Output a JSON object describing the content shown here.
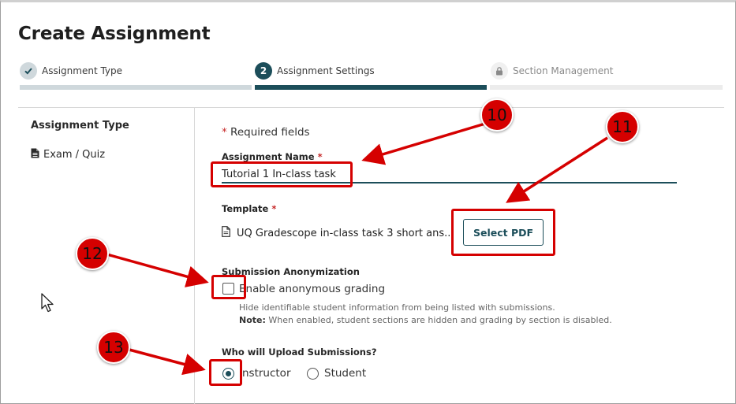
{
  "page": {
    "title": "Create Assignment"
  },
  "stepper": {
    "steps": [
      {
        "label": "Assignment Type",
        "number": "",
        "state": "complete"
      },
      {
        "label": "Assignment Settings",
        "number": "2",
        "state": "active"
      },
      {
        "label": "Section Management",
        "number": "",
        "state": "locked"
      }
    ]
  },
  "sidebar": {
    "heading": "Assignment Type",
    "item": "Exam / Quiz"
  },
  "form": {
    "required_note": "Required fields",
    "required_star": "*",
    "assignment_name": {
      "label": "Assignment Name",
      "value": "Tutorial 1 In-class task"
    },
    "template": {
      "label": "Template",
      "file_name": "UQ Gradescope in-class task 3 short ans...",
      "button": "Select PDF"
    },
    "anonymization": {
      "label": "Submission Anonymization",
      "checkbox_label": "Enable anonymous grading",
      "checked": false,
      "help": "Hide identifiable student information from being listed with submissions.",
      "note_prefix": "Note:",
      "note": "When enabled, student sections are hidden and grading by section is disabled."
    },
    "uploader": {
      "label": "Who will Upload Submissions?",
      "options": [
        {
          "label": "Instructor",
          "selected": true
        },
        {
          "label": "Student",
          "selected": false
        }
      ]
    }
  },
  "annotations": {
    "badges": [
      "10",
      "11",
      "12",
      "13"
    ],
    "color": "#d50000"
  },
  "colors": {
    "accent": "#1c4e5a",
    "required": "#c62828"
  }
}
